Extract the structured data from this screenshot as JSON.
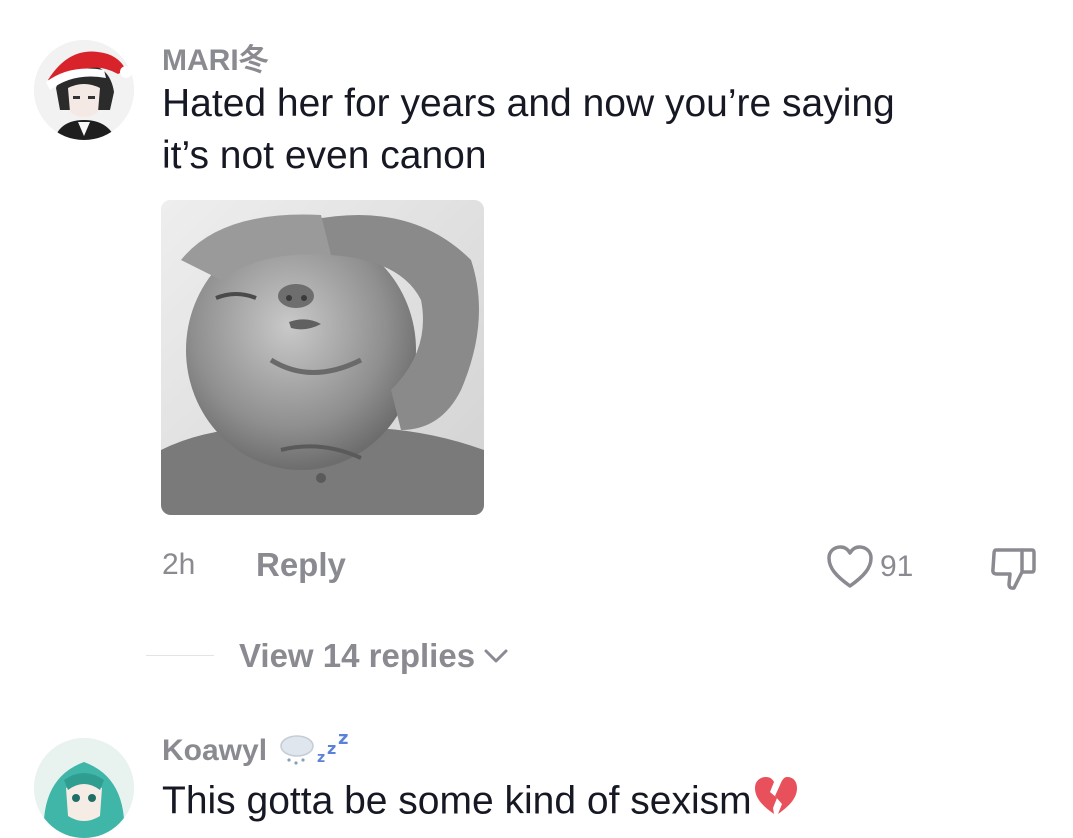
{
  "comments": [
    {
      "username": "MARI冬",
      "text_line1": "Hated her for years and now you’re saying",
      "text_line2": "it’s not even canon",
      "has_sticker": true,
      "time": "2h",
      "reply_label": "Reply",
      "like_count": "91",
      "view_replies_label": "View 14 replies",
      "avatar_icon": "anime-boy-santa-hat-avatar"
    },
    {
      "username": "Koawyl",
      "username_emoji": "cloud-snow-zzz-emoji",
      "text": "This gotta be some kind of sexism",
      "text_emoji": "broken-heart-emoji",
      "avatar_icon": "anime-girl-teal-hair-avatar"
    }
  ],
  "colors": {
    "secondary_text": "#8a8b91",
    "primary_text": "#161823",
    "santa_red": "#d8232a",
    "broken_heart": "#e8505b",
    "teal_hair": "#3fb6a8"
  }
}
